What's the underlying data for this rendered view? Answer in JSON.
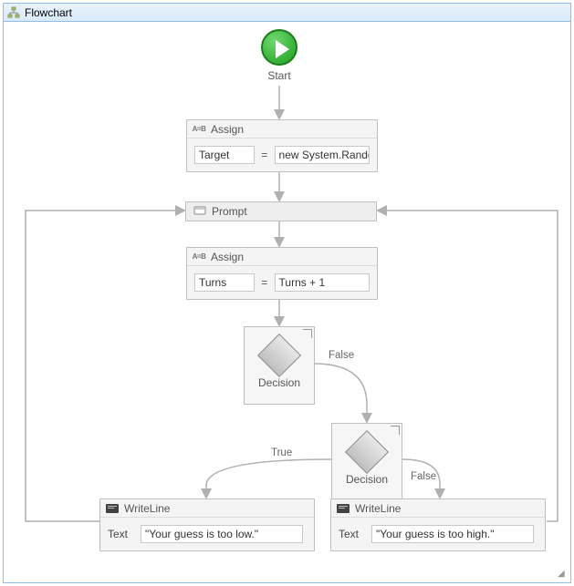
{
  "panel": {
    "title": "Flowchart"
  },
  "start": {
    "label": "Start"
  },
  "assign1": {
    "header": "Assign",
    "left": "Target",
    "right": "new System.Random"
  },
  "prompt": {
    "label": "Prompt"
  },
  "assign2": {
    "header": "Assign",
    "left": "Turns",
    "right": "Turns + 1"
  },
  "decision1": {
    "label": "Decision",
    "falseLabel": "False"
  },
  "decision2": {
    "label": "Decision",
    "trueLabel": "True",
    "falseLabel": "False"
  },
  "writeLow": {
    "header": "WriteLine",
    "fieldLabel": "Text",
    "value": "\"Your guess is too low.\""
  },
  "writeHigh": {
    "header": "WriteLine",
    "fieldLabel": "Text",
    "value": "\"Your guess is too high.\""
  }
}
